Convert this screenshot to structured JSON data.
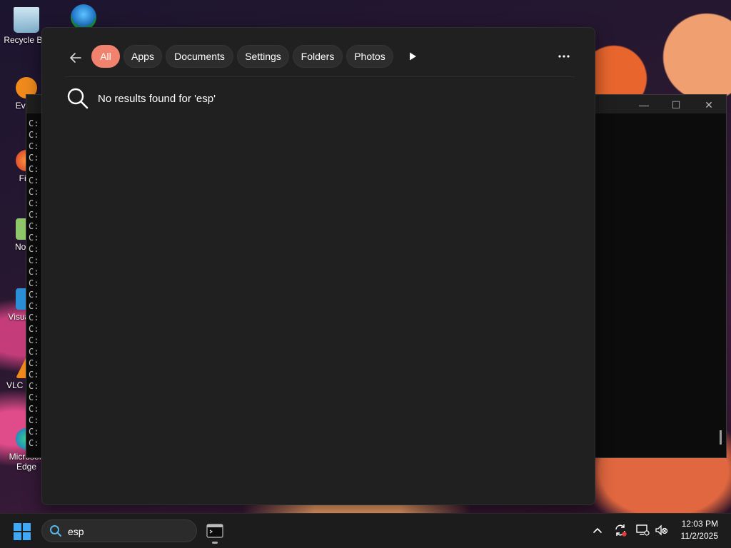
{
  "desktop": {
    "icons": [
      {
        "label": "Recycle Bin"
      },
      {
        "label": "Every"
      },
      {
        "label": "Fire"
      },
      {
        "label": "Notep"
      },
      {
        "label": "Visual Co"
      },
      {
        "label": "VLC m pla"
      },
      {
        "label": "Microsoft Edge"
      }
    ]
  },
  "console": {
    "prompt_lines": [
      "C:",
      "C:",
      "C:",
      "C:",
      "C:",
      "C:",
      "C:",
      "C:",
      "C:",
      "C:",
      "C:",
      "C:",
      "C:",
      "C:",
      "C:",
      "C:",
      "C:",
      "C:",
      "C:",
      "C:",
      "C:",
      "C:",
      "C:",
      "C:",
      "C:",
      "C:",
      "C:",
      "C:",
      "C:"
    ],
    "minimize": "—",
    "maximize": "☐",
    "close": "✕"
  },
  "search_flyout": {
    "filters": [
      "All",
      "Apps",
      "Documents",
      "Settings",
      "Folders",
      "Photos"
    ],
    "active_filter": "All",
    "result_message": "No results found for 'esp'",
    "accent_color": "#f0826e"
  },
  "taskbar": {
    "search_value": "esp",
    "clock_time": "12:03 PM",
    "clock_date": "11/2/2025"
  }
}
